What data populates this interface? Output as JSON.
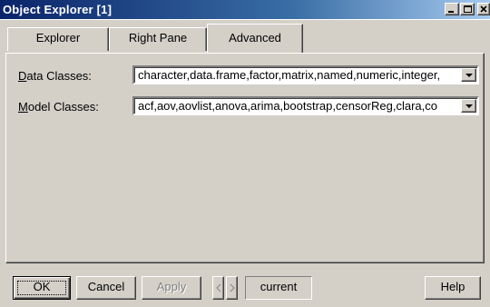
{
  "window": {
    "title": "Object Explorer [1]"
  },
  "tabs": [
    {
      "label": "Explorer",
      "active": false
    },
    {
      "label": "Right Pane",
      "active": false
    },
    {
      "label": "Advanced",
      "active": true
    }
  ],
  "fields": {
    "data_classes": {
      "label_accel": "D",
      "label_rest": "ata Classes:",
      "value": "character,data.frame,factor,matrix,named,numeric,integer,"
    },
    "model_classes": {
      "label_accel": "M",
      "label_rest": "odel Classes:",
      "value": "acf,aov,aovlist,anova,arima,bootstrap,censorReg,clara,co"
    }
  },
  "buttons": {
    "ok": "OK",
    "cancel": "Cancel",
    "apply": "Apply",
    "prev": "<",
    "next": ">",
    "current": "current",
    "help": "Help"
  }
}
